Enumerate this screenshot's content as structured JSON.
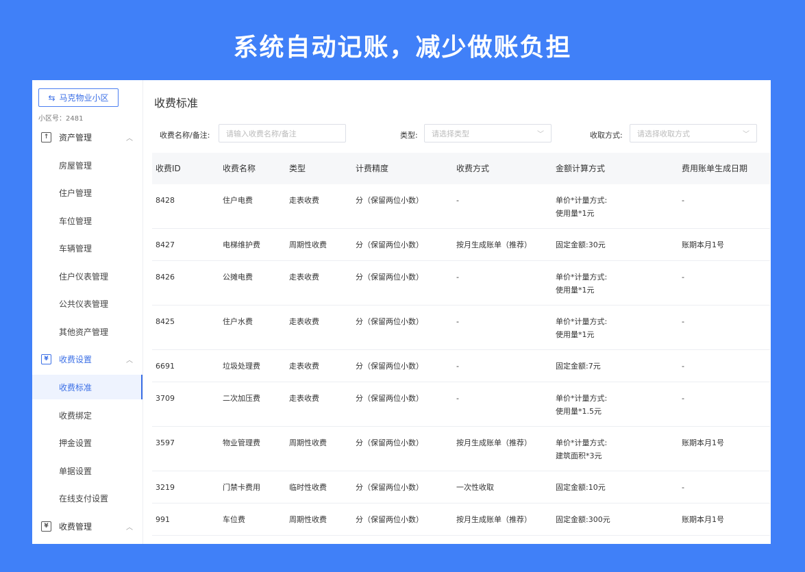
{
  "banner": {
    "title": "系统自动记账，减少做账负担"
  },
  "sidebar": {
    "community_button": "马克物业小区",
    "community_id": "小区号：2481",
    "groups": [
      {
        "label": "资产管理",
        "icon": "asset-icon"
      },
      {
        "label": "收费设置",
        "icon": "fee-settings-icon"
      },
      {
        "label": "收费管理",
        "icon": "fee-management-icon"
      }
    ],
    "asset_items": [
      "房屋管理",
      "住户管理",
      "车位管理",
      "车辆管理",
      "住户仪表管理",
      "公共仪表管理",
      "其他资产管理"
    ],
    "fee_items": [
      "收费标准",
      "收费绑定",
      "押金设置",
      "单据设置",
      "在线支付设置"
    ]
  },
  "main": {
    "page_title": "收费标准",
    "filters": {
      "name_label": "收费名称/备注:",
      "name_placeholder": "请输入收费名称/备注",
      "type_label": "类型:",
      "type_placeholder": "请选择类型",
      "method_label": "收取方式:",
      "method_placeholder": "请选择收取方式"
    },
    "table": {
      "headers": [
        "收费ID",
        "收费名称",
        "类型",
        "计费精度",
        "收费方式",
        "金额计算方式",
        "费用账单生成日期"
      ],
      "rows": [
        [
          "8428",
          "住户电费",
          "走表收费",
          "分（保留两位小数）",
          "-",
          "单价*计量方式:",
          "使用量*1元",
          "-"
        ],
        [
          "8427",
          "电梯维护费",
          "周期性收费",
          "分（保留两位小数）",
          "按月生成账单（推荐）",
          "固定金额:30元",
          "",
          "账期本月1号"
        ],
        [
          "8426",
          "公摊电费",
          "走表收费",
          "分（保留两位小数）",
          "-",
          "单价*计量方式:",
          "使用量*1元",
          "-"
        ],
        [
          "8425",
          "住户水费",
          "走表收费",
          "分（保留两位小数）",
          "-",
          "单价*计量方式:",
          "使用量*1元",
          "-"
        ],
        [
          "6691",
          "垃圾处理费",
          "走表收费",
          "分（保留两位小数）",
          "-",
          "固定金额:7元",
          "",
          "-"
        ],
        [
          "3709",
          "二次加压费",
          "走表收费",
          "分（保留两位小数）",
          "-",
          "单价*计量方式:",
          "使用量*1.5元",
          "-"
        ],
        [
          "3597",
          "物业管理费",
          "周期性收费",
          "分（保留两位小数）",
          "按月生成账单（推荐）",
          "单价*计量方式:",
          "建筑面积*3元",
          "账期本月1号"
        ],
        [
          "3219",
          "门禁卡费用",
          "临时性收费",
          "分（保留两位小数）",
          "一次性收取",
          "固定金额:10元",
          "",
          "-"
        ],
        [
          "991",
          "车位费",
          "周期性收费",
          "分（保留两位小数）",
          "按月生成账单（推荐）",
          "固定金额:300元",
          "",
          "账期本月1号"
        ]
      ]
    }
  }
}
